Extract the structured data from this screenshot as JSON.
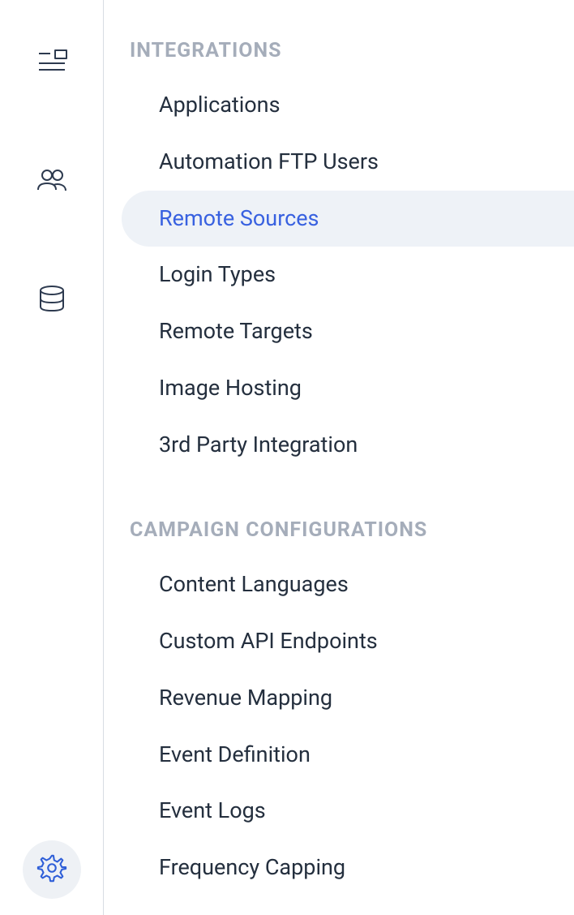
{
  "rail_icons": {
    "top": "list-icon",
    "middle": "people-icon",
    "lower": "database-icon",
    "bottom": "gear-icon"
  },
  "sections": [
    {
      "header": "INTEGRATIONS",
      "items": [
        {
          "label": "Applications",
          "active": false
        },
        {
          "label": "Automation FTP Users",
          "active": false
        },
        {
          "label": "Remote Sources",
          "active": true
        },
        {
          "label": "Login Types",
          "active": false
        },
        {
          "label": "Remote Targets",
          "active": false
        },
        {
          "label": "Image Hosting",
          "active": false
        },
        {
          "label": "3rd Party Integration",
          "active": false
        }
      ]
    },
    {
      "header": "CAMPAIGN CONFIGURATIONS",
      "items": [
        {
          "label": "Content Languages",
          "active": false
        },
        {
          "label": "Custom API Endpoints",
          "active": false
        },
        {
          "label": "Revenue Mapping",
          "active": false
        },
        {
          "label": "Event Definition",
          "active": false
        },
        {
          "label": "Event Logs",
          "active": false
        },
        {
          "label": "Frequency Capping",
          "active": false
        }
      ]
    }
  ]
}
